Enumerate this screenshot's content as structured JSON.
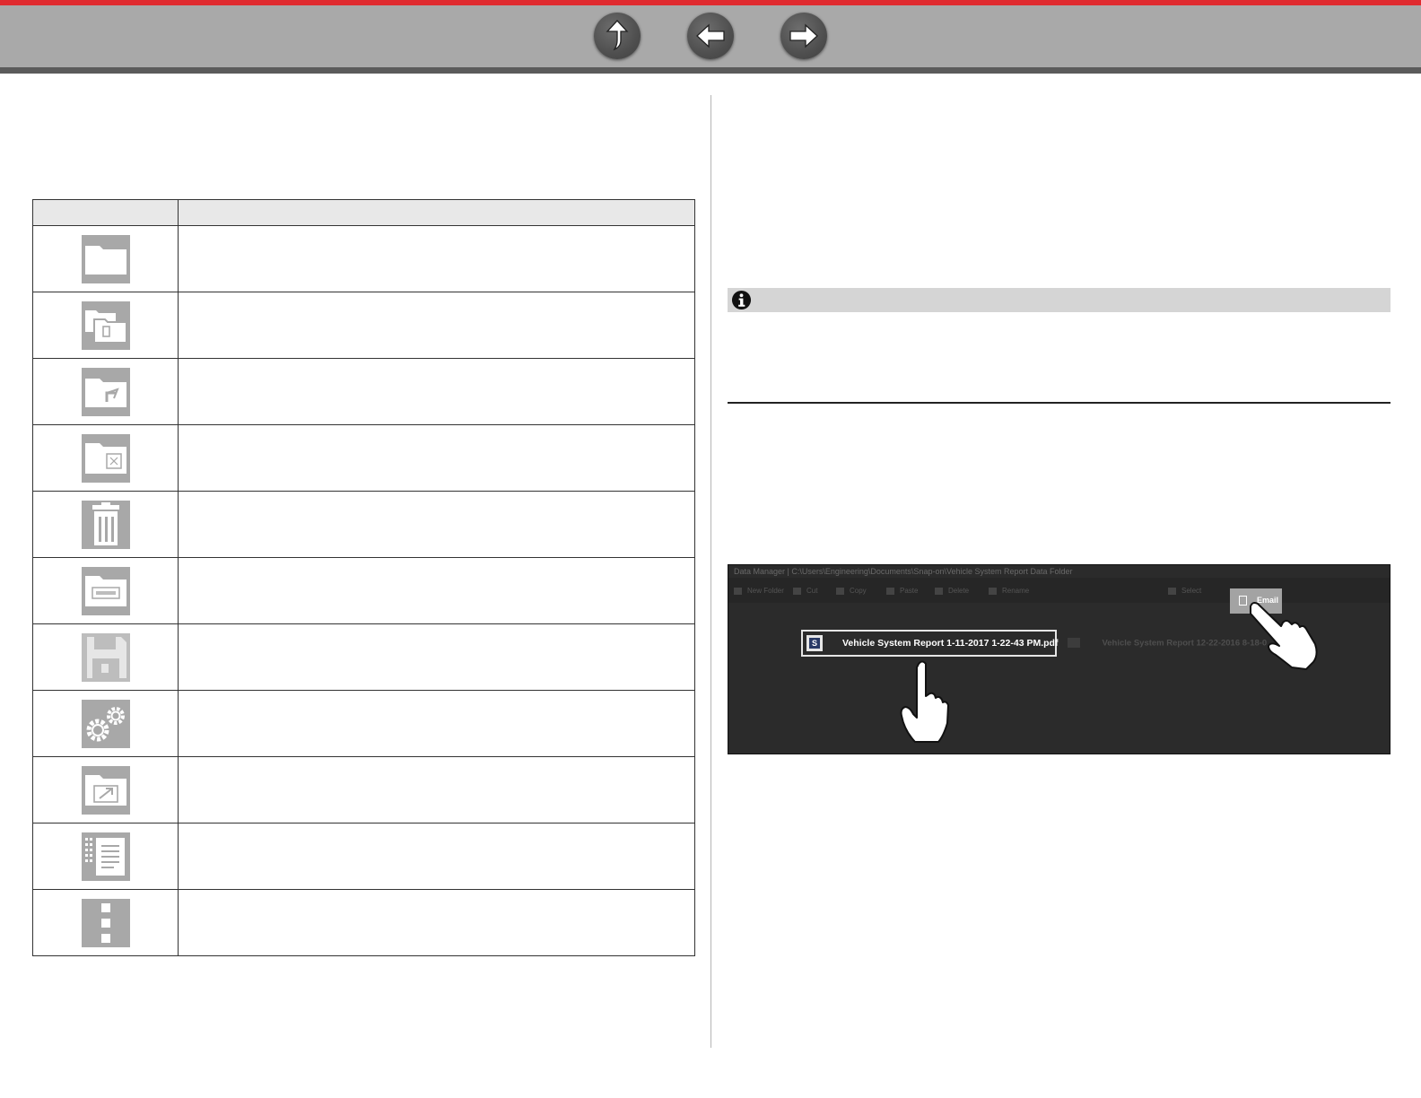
{
  "nav": {
    "up_icon": "up-arrow-icon",
    "back_icon": "left-arrow-icon",
    "forward_icon": "right-arrow-icon"
  },
  "colors": {
    "top_stripe": "#e02a2f",
    "nav_bar": "#a9a9a9",
    "nav_bar_bottom": "#5b5b5b",
    "note_bar": "#d5d5d5",
    "screenshot_bg": "#2b2b2b"
  },
  "icon_table": {
    "rows": [
      {
        "icon": "folder-icon"
      },
      {
        "icon": "copy-folder-icon"
      },
      {
        "icon": "move-folder-icon"
      },
      {
        "icon": "paste-folder-icon"
      },
      {
        "icon": "trash-icon"
      },
      {
        "icon": "rename-folder-icon"
      },
      {
        "icon": "floppy-disk-icon"
      },
      {
        "icon": "gears-icon"
      },
      {
        "icon": "export-folder-icon"
      },
      {
        "icon": "list-view-icon"
      },
      {
        "icon": "more-options-icon"
      }
    ]
  },
  "note": {
    "icon": "info-icon"
  },
  "screenshot": {
    "email_label": "Email",
    "email_icon": "email-icon",
    "selected_file": "Vehicle System Report 1-11-2017 1-22-43 PM.pdf",
    "other_file": "Vehicle System Report 12-22-2016 8-18-0",
    "hand_icons": [
      "pointing-hand-icon",
      "pointing-hand-icon"
    ]
  }
}
